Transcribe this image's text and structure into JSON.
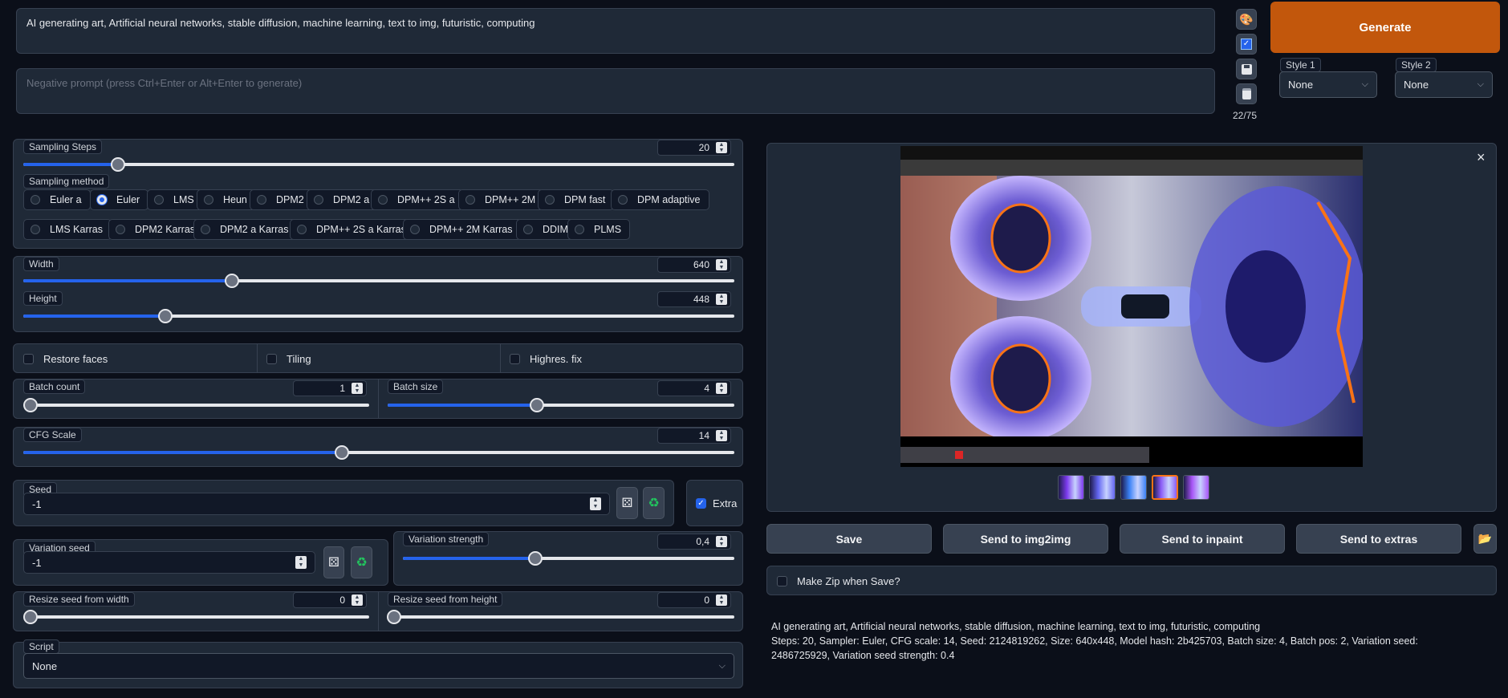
{
  "prompt": {
    "text": "AI generating art, Artificial neural networks, stable diffusion, machine learning, text to img, futuristic, computing",
    "negative_placeholder": "Negative prompt (press Ctrl+Enter or Alt+Enter to generate)",
    "token_count": "22/75"
  },
  "tools": {
    "icons": [
      "palette-icon",
      "checkbox-icon",
      "save-icon",
      "clipboard-icon"
    ]
  },
  "generate": {
    "label": "Generate"
  },
  "styles": [
    {
      "label": "Style 1",
      "value": "None"
    },
    {
      "label": "Style 2",
      "value": "None"
    }
  ],
  "sampling": {
    "steps_label": "Sampling Steps",
    "steps_value": "20",
    "steps_fraction": 0.133,
    "method_label": "Sampling method",
    "methods_row1": [
      "Euler a",
      "Euler",
      "LMS",
      "Heun",
      "DPM2",
      "DPM2 a",
      "DPM++ 2S a",
      "DPM++ 2M",
      "DPM fast",
      "DPM adaptive"
    ],
    "methods_row2": [
      "LMS Karras",
      "DPM2 Karras",
      "DPM2 a Karras",
      "DPM++ 2S a Karras",
      "DPM++ 2M Karras",
      "DDIM",
      "PLMS"
    ],
    "selected": "Euler"
  },
  "size": {
    "width_label": "Width",
    "width_value": "640",
    "width_fraction": 0.294,
    "height_label": "Height",
    "height_value": "448",
    "height_fraction": 0.2
  },
  "options": {
    "restore_faces": "Restore faces",
    "tiling": "Tiling",
    "highres": "Highres. fix"
  },
  "batch": {
    "count_label": "Batch count",
    "count_value": "1",
    "count_fraction": 0.0,
    "size_label": "Batch size",
    "size_value": "4",
    "size_fraction": 0.43
  },
  "cfg": {
    "label": "CFG Scale",
    "value": "14",
    "fraction": 0.448
  },
  "seed": {
    "label": "Seed",
    "value": "-1",
    "extra_label": "Extra"
  },
  "variation": {
    "seed_label": "Variation seed",
    "seed_value": "-1",
    "strength_label": "Variation strength",
    "strength_value": "0,4",
    "strength_fraction": 0.4
  },
  "resize": {
    "width_label": "Resize seed from width",
    "width_value": "0",
    "height_label": "Resize seed from height",
    "height_value": "0"
  },
  "script": {
    "label": "Script",
    "value": "None"
  },
  "gallery": {
    "close": "×",
    "thumbnails": 5,
    "selected_index": 3
  },
  "actions": {
    "save": "Save",
    "img2img": "Send to img2img",
    "inpaint": "Send to inpaint",
    "extras": "Send to extras"
  },
  "zip": {
    "label": "Make Zip when Save?"
  },
  "info": {
    "prompt": "AI generating art, Artificial neural networks, stable diffusion, machine learning, text to img, futuristic, computing",
    "params": "Steps: 20, Sampler: Euler, CFG scale: 14, Seed: 2124819262, Size: 640x448, Model hash: 2b425703, Batch size: 4, Batch pos: 2, Variation seed: 2486725929, Variation seed strength: 0.4"
  },
  "colors": {
    "accent": "#2563eb",
    "generate": "#c2570c",
    "background": "#0b0f19",
    "panel": "#1f2937"
  }
}
